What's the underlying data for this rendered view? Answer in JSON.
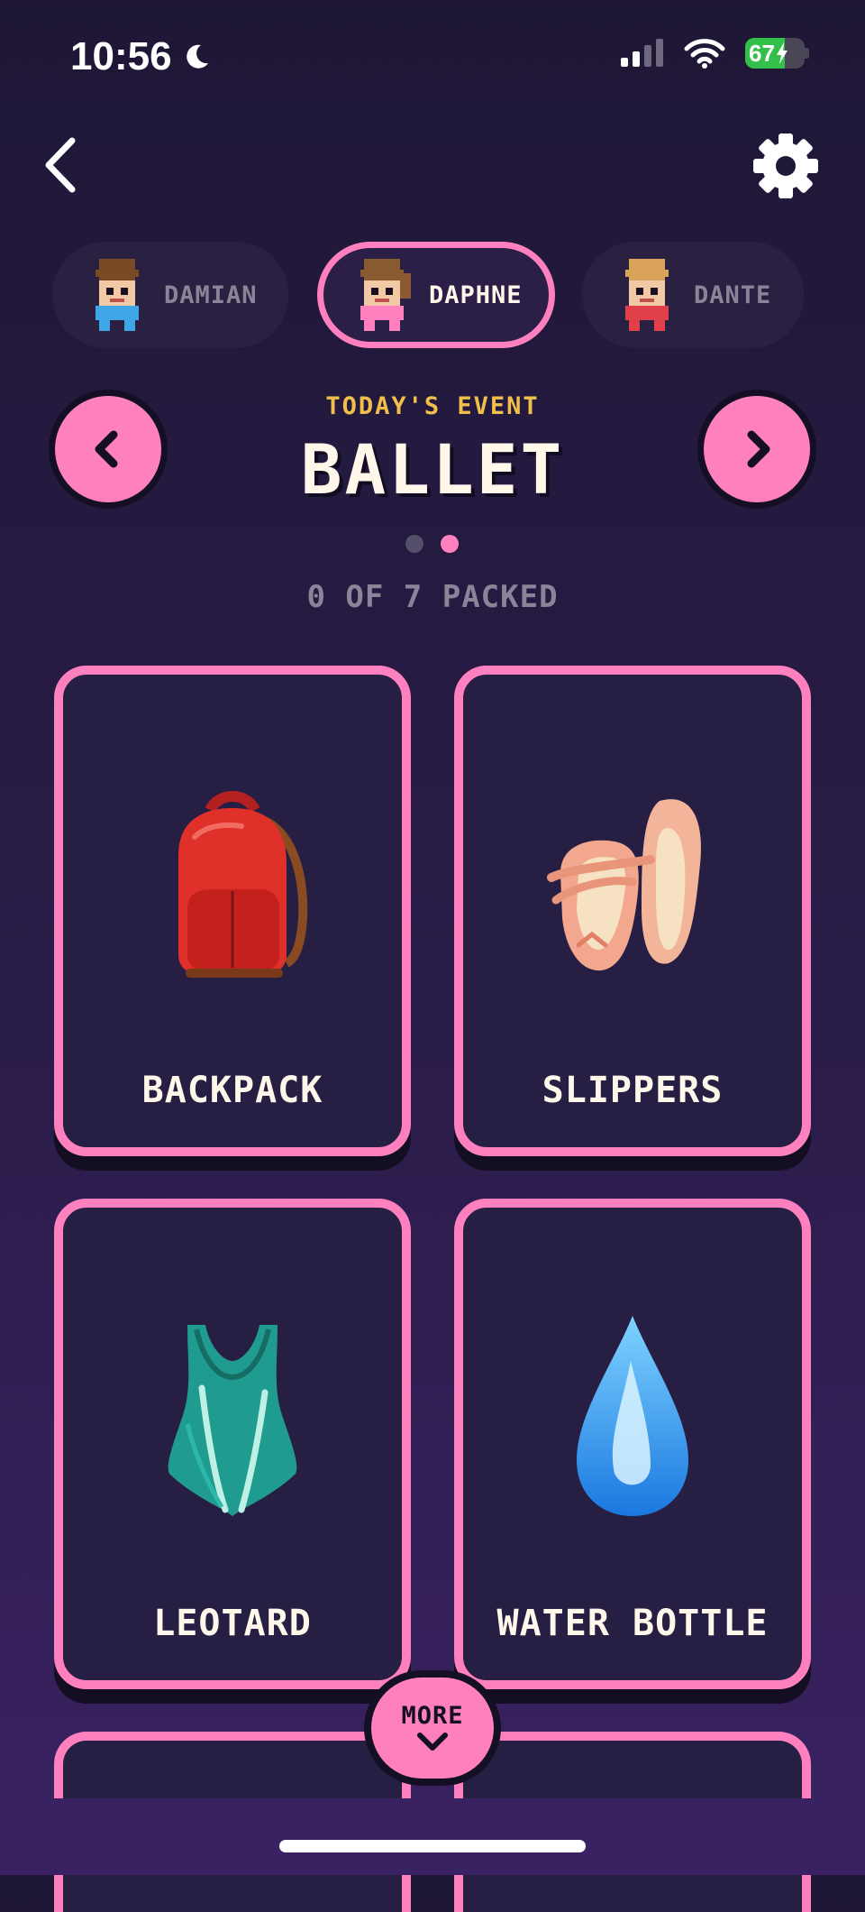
{
  "status_bar": {
    "time": "10:56",
    "battery": "67",
    "battery_level": 0.67
  },
  "profiles": [
    {
      "name": "DAMIAN",
      "active": false
    },
    {
      "name": "DAPHNE",
      "active": true
    },
    {
      "name": "DANTE",
      "active": false
    }
  ],
  "event": {
    "label": "TODAY'S EVENT",
    "title": "BALLET",
    "page_index": 2,
    "page_count": 2
  },
  "packed_status": "0 OF 7 PACKED",
  "items": [
    {
      "label": "BACKPACK",
      "icon": "backpack-icon"
    },
    {
      "label": "SLIPPERS",
      "icon": "ballet-shoes-icon"
    },
    {
      "label": "LEOTARD",
      "icon": "leotard-icon"
    },
    {
      "label": "WATER BOTTLE",
      "icon": "water-drop-icon"
    }
  ],
  "more_button": {
    "label": "MORE",
    "icon": "chevron-down-icon"
  },
  "colors": {
    "accent": "#ff80bf",
    "event_label": "#f2c04a",
    "card_bg": "#271e44",
    "background": "#1f1736"
  }
}
